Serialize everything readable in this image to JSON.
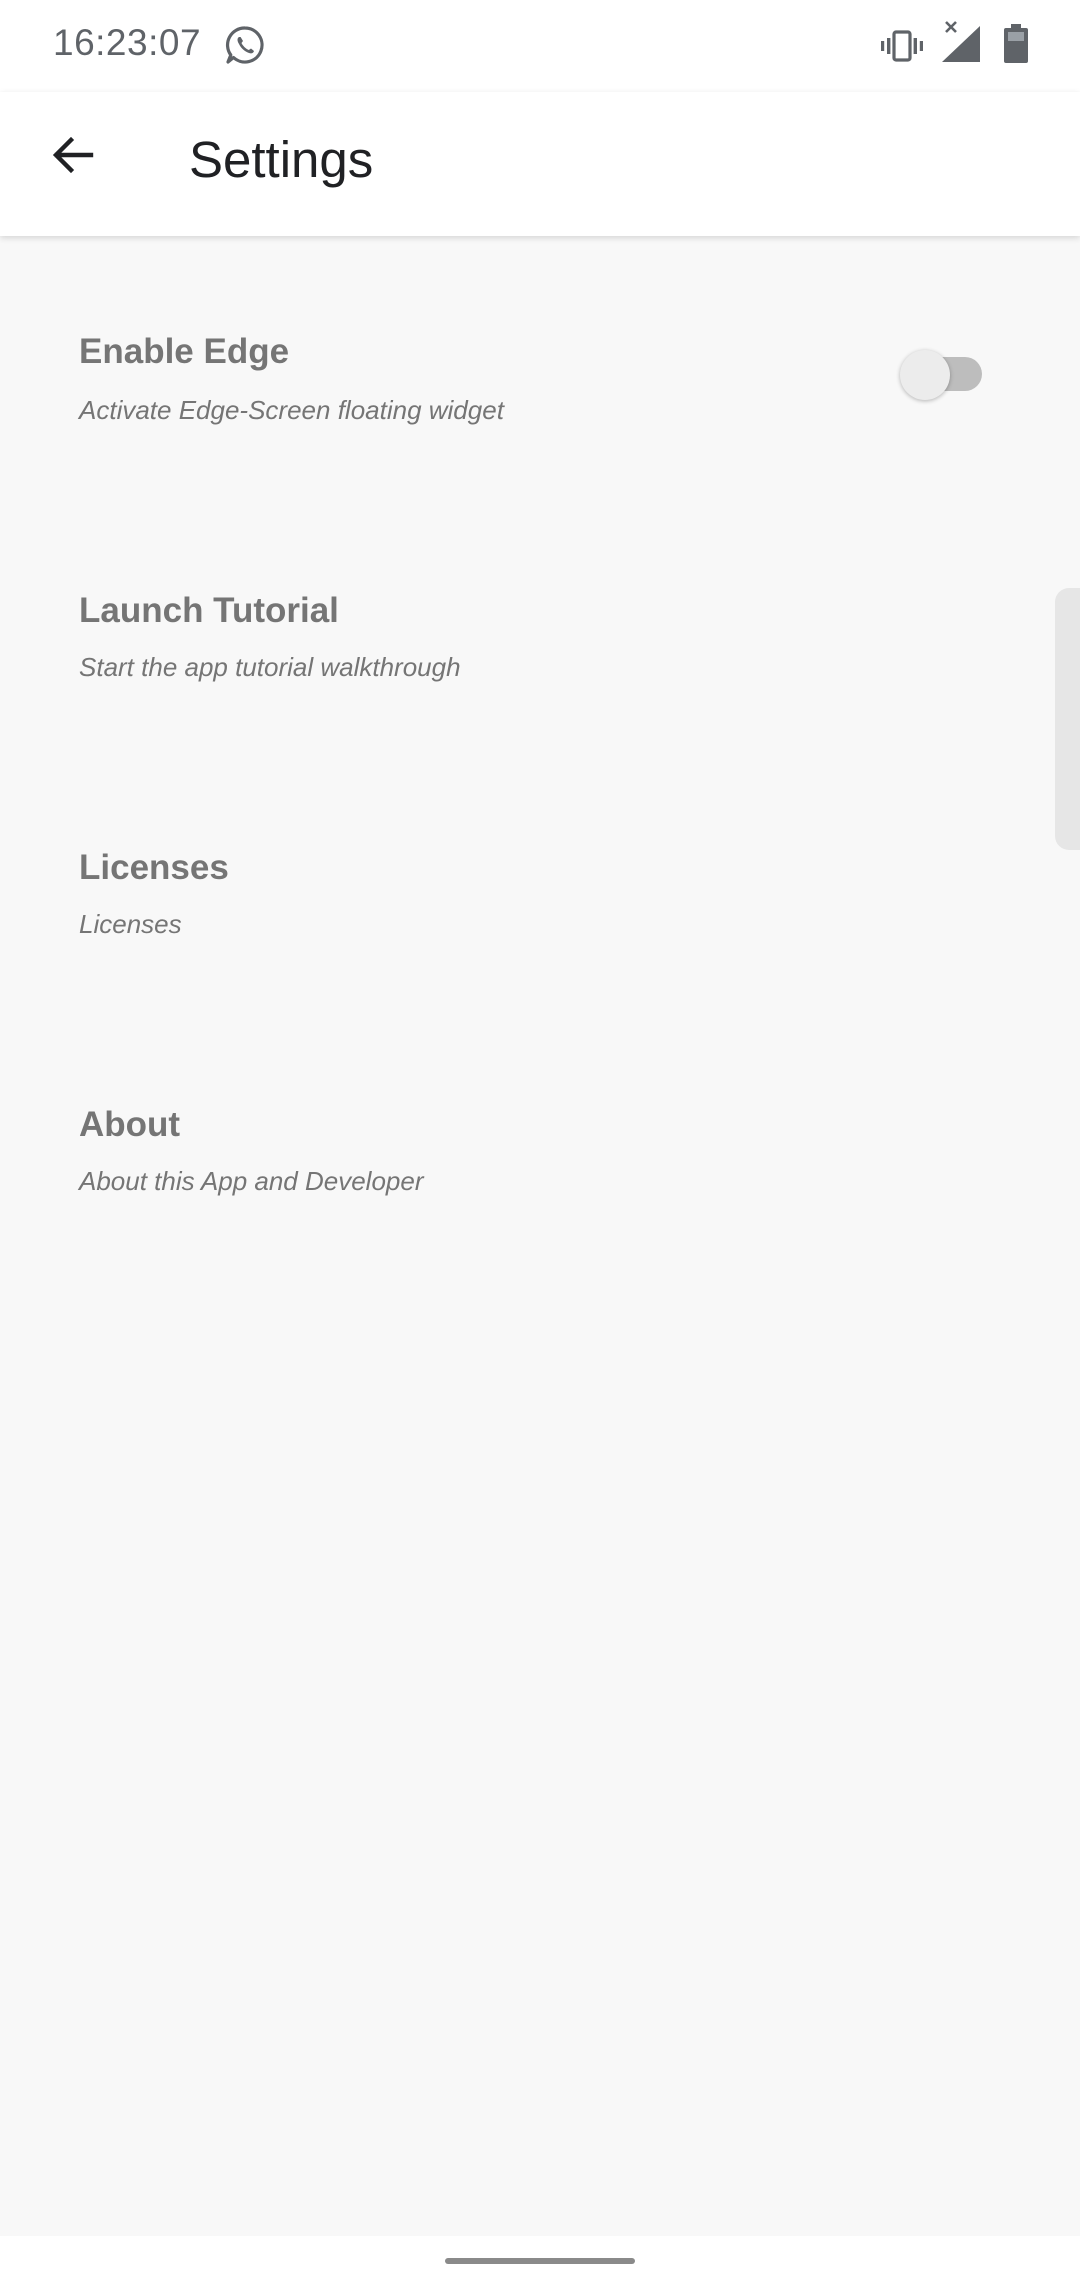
{
  "status_bar": {
    "time": "16:23:07",
    "icons": [
      "whatsapp-icon",
      "vibrate-icon",
      "signal-no-service-icon",
      "battery-icon"
    ]
  },
  "app_bar": {
    "back_icon": "arrow-back-icon",
    "title": "Settings"
  },
  "settings": [
    {
      "title": "Enable Edge",
      "summary": "Activate Edge-Screen floating widget",
      "toggle": {
        "on": false
      }
    },
    {
      "title": "Launch Tutorial",
      "summary": "Start the app tutorial walkthrough"
    },
    {
      "title": "Licenses",
      "summary": "Licenses"
    },
    {
      "title": "About",
      "summary": "About this App and Developer"
    }
  ],
  "colors": {
    "background": "#f8f8f8",
    "bar_background": "#ffffff",
    "title_text": "#202124",
    "item_text": "#757575",
    "toggle_track_off": "#bdbdbd",
    "toggle_thumb_off": "#ececec"
  }
}
